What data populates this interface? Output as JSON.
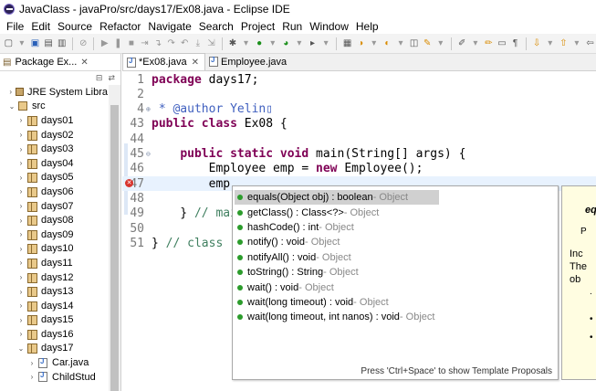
{
  "window": {
    "title": "JavaClass - javaPro/src/days17/Ex08.java - Eclipse IDE"
  },
  "menu": [
    "File",
    "Edit",
    "Source",
    "Refactor",
    "Navigate",
    "Search",
    "Project",
    "Run",
    "Window",
    "Help"
  ],
  "package_explorer": {
    "tab_label": "Package Ex...",
    "tree": [
      {
        "label": "JRE System Libra",
        "kind": "jar",
        "indent": 1,
        "expanded": false
      },
      {
        "label": "src",
        "kind": "src",
        "indent": 1,
        "expanded": true
      },
      {
        "label": "days01",
        "kind": "pkg",
        "indent": 2,
        "expanded": false
      },
      {
        "label": "days02",
        "kind": "pkg",
        "indent": 2,
        "expanded": false
      },
      {
        "label": "days03",
        "kind": "pkg",
        "indent": 2,
        "expanded": false
      },
      {
        "label": "days04",
        "kind": "pkg",
        "indent": 2,
        "expanded": false
      },
      {
        "label": "days05",
        "kind": "pkg",
        "indent": 2,
        "expanded": false
      },
      {
        "label": "days06",
        "kind": "pkg",
        "indent": 2,
        "expanded": false
      },
      {
        "label": "days07",
        "kind": "pkg",
        "indent": 2,
        "expanded": false
      },
      {
        "label": "days08",
        "kind": "pkg",
        "indent": 2,
        "expanded": false
      },
      {
        "label": "days09",
        "kind": "pkg",
        "indent": 2,
        "expanded": false
      },
      {
        "label": "days10",
        "kind": "pkg",
        "indent": 2,
        "expanded": false
      },
      {
        "label": "days11",
        "kind": "pkg",
        "indent": 2,
        "expanded": false
      },
      {
        "label": "days12",
        "kind": "pkg",
        "indent": 2,
        "expanded": false
      },
      {
        "label": "days13",
        "kind": "pkg",
        "indent": 2,
        "expanded": false
      },
      {
        "label": "days14",
        "kind": "pkg",
        "indent": 2,
        "expanded": false
      },
      {
        "label": "days15",
        "kind": "pkg",
        "indent": 2,
        "expanded": false
      },
      {
        "label": "days16",
        "kind": "pkg",
        "indent": 2,
        "expanded": false
      },
      {
        "label": "days17",
        "kind": "pkg",
        "indent": 2,
        "expanded": true
      },
      {
        "label": "Car.java",
        "kind": "jfile",
        "indent": 3,
        "expanded": false
      },
      {
        "label": "ChildStud",
        "kind": "jfile",
        "indent": 3,
        "expanded": false
      }
    ]
  },
  "editor": {
    "tabs": [
      {
        "label": "*Ex08.java",
        "active": true
      },
      {
        "label": "Employee.java",
        "active": false
      }
    ],
    "lines": [
      {
        "num": "1",
        "html": "<span class=\"kw\">package</span> days17;"
      },
      {
        "num": "2",
        "html": ""
      },
      {
        "num": "4",
        "fold": "⊕",
        "html": "<span class=\"cm\"> * @author Yelin▯</span>"
      },
      {
        "num": "43",
        "html": "<span class=\"kw\">public class</span> Ex08 {"
      },
      {
        "num": "44",
        "html": ""
      },
      {
        "num": "45",
        "fold": "⊖",
        "html": "    <span class=\"kw\">public static void</span> main(String[] args) {"
      },
      {
        "num": "46",
        "html": "        Employee emp = <span class=\"kw\">new</span> Employee();"
      },
      {
        "num": "47",
        "error": true,
        "current": true,
        "html": "        emp."
      },
      {
        "num": "48",
        "html": ""
      },
      {
        "num": "49",
        "html": "    } <span class=\"cm2\">// main</span>"
      },
      {
        "num": "50",
        "html": ""
      },
      {
        "num": "51",
        "html": "} <span class=\"cm2\">// class</span>"
      }
    ]
  },
  "content_assist": {
    "proposals": [
      {
        "sig": "equals(Object obj) : boolean",
        "owner": " - Object",
        "selected": true
      },
      {
        "sig": "getClass() : Class<?>",
        "owner": " - Object",
        "selected": false
      },
      {
        "sig": "hashCode() : int",
        "owner": " - Object",
        "selected": false
      },
      {
        "sig": "notify() : void",
        "owner": " - Object",
        "selected": false
      },
      {
        "sig": "notifyAll() : void",
        "owner": " - Object",
        "selected": false
      },
      {
        "sig": "toString() : String",
        "owner": " - Object",
        "selected": false
      },
      {
        "sig": "wait() : void",
        "owner": " - Object",
        "selected": false
      },
      {
        "sig": "wait(long timeout) : void",
        "owner": " - Object",
        "selected": false
      },
      {
        "sig": "wait(long timeout, int nanos) : void",
        "owner": " - Object",
        "selected": false
      }
    ],
    "footer": "Press 'Ctrl+Space' to show Template Proposals"
  },
  "javadoc": {
    "l1": "eq",
    "l2": "P",
    "l3": "Inc",
    "l4": "The",
    "l5": "ob",
    "l6": ".",
    "l7": "•",
    "l8": "•"
  },
  "colors": {
    "keyword": "#7f0055",
    "javadoc": "#3f5fbf",
    "comment": "#3f7f5f",
    "current_line": "#e8f2fe",
    "error": "#d8342d"
  }
}
